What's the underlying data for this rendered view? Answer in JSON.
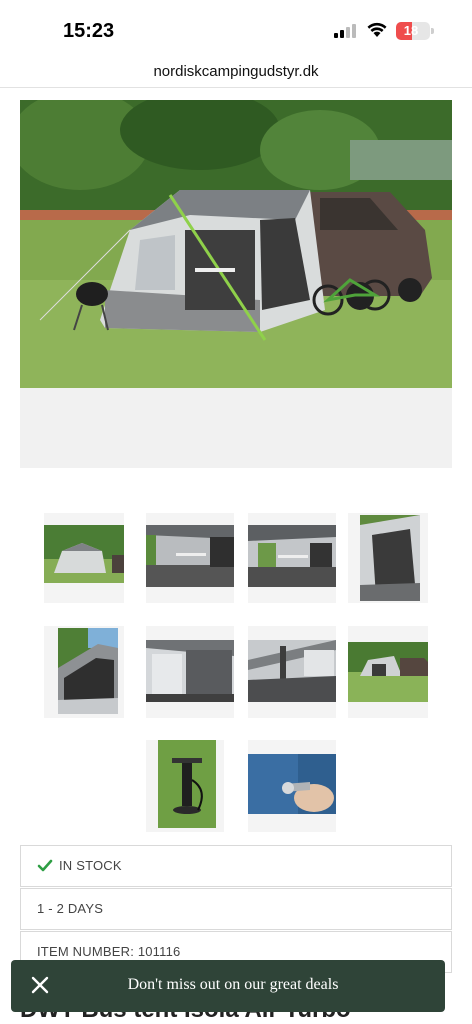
{
  "status_bar": {
    "time": "15:23",
    "battery_level": "18",
    "icons": [
      "signal-icon",
      "wifi-icon",
      "battery-icon"
    ]
  },
  "browser": {
    "url": "nordiskcampingudstyr.dk"
  },
  "product": {
    "main_image": "tent-awning-with-van-photo",
    "thumbnails": [
      "tent-exterior-thumbnail",
      "tent-interior-table-thumbnail",
      "tent-interior-wide-thumbnail",
      "tent-side-view-thumbnail",
      "tent-side-panel-thumbnail",
      "tent-inner-room-thumbnail",
      "tent-floor-thumbnail",
      "tent-with-van-thumbnail",
      "air-pump-thumbnail",
      "valve-hand-thumbnail"
    ],
    "stock_status": "IN STOCK",
    "delivery": "1 - 2 DAYS",
    "item_number": "ITEM NUMBER: 101116",
    "title_partial": "DWT Bus tent Isola Air Turbo"
  },
  "toast": {
    "message": "Don't miss out on our great deals"
  },
  "colors": {
    "toast_bg": "#2f4438",
    "stock_check": "#2e9e44",
    "battery_low": "#ef4d4d"
  }
}
